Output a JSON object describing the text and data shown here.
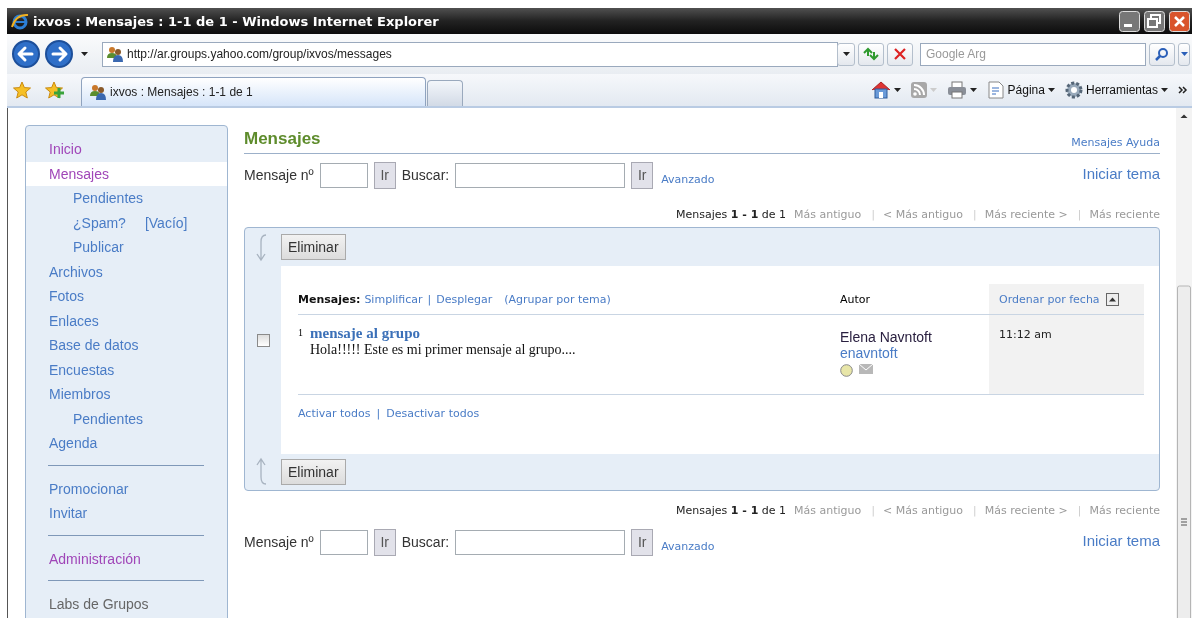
{
  "window": {
    "title": "ixvos : Mensajes : 1-1 de 1 - Windows Internet Explorer"
  },
  "address_bar": {
    "url": "http://ar.groups.yahoo.com/group/ixvos/messages"
  },
  "search_box": {
    "placeholder": "Google Arg"
  },
  "tabs": [
    {
      "label": "ixvos : Mensajes : 1-1 de 1",
      "selected": true
    }
  ],
  "command_bar": [
    {
      "label": "Página",
      "kind": "page"
    },
    {
      "label": "Herramientas",
      "kind": "tools"
    }
  ],
  "sidebar": {
    "groups": [
      {
        "items": [
          {
            "label": "Inicio",
            "kind": "visited",
            "selected": false
          },
          {
            "label": "Mensajes",
            "kind": "visited",
            "selected": true,
            "children": [
              {
                "label": "Pendientes",
                "kind": "link",
                "selected": false
              },
              {
                "label": "¿Spam?",
                "extra": "[Vacío]",
                "kind": "link",
                "selected": false
              },
              {
                "label": "Publicar",
                "kind": "link",
                "selected": false
              }
            ]
          },
          {
            "label": "Archivos",
            "kind": "link",
            "selected": false
          },
          {
            "label": "Fotos",
            "kind": "link",
            "selected": false
          },
          {
            "label": "Enlaces",
            "kind": "link",
            "selected": false
          },
          {
            "label": "Base de datos",
            "kind": "link",
            "selected": false
          },
          {
            "label": "Encuestas",
            "kind": "link",
            "selected": false
          },
          {
            "label": "Miembros",
            "kind": "link",
            "selected": false,
            "children": [
              {
                "label": "Pendientes",
                "kind": "link",
                "selected": false
              }
            ]
          },
          {
            "label": "Agenda",
            "kind": "link",
            "selected": false
          }
        ]
      },
      {
        "items": [
          {
            "label": "Promocionar",
            "kind": "link",
            "selected": false
          },
          {
            "label": "Invitar",
            "kind": "link",
            "selected": false
          }
        ]
      },
      {
        "items": [
          {
            "label": "Administración",
            "kind": "visited",
            "selected": false
          }
        ]
      },
      {
        "items": [
          {
            "label": "Labs de Grupos",
            "kind": "text",
            "selected": false
          }
        ]
      }
    ]
  },
  "page": {
    "title": "Mensajes",
    "help_link": "Mensajes Ayuda",
    "controls": [
      {
        "number_label": "Mensaje nº",
        "go_button": "Ir",
        "search_label": "Buscar:",
        "search_button": "Ir",
        "advanced_link": "Avanzado",
        "new_topic_link": "Iniciar tema"
      },
      {
        "number_label": "Mensaje nº",
        "go_button": "Ir",
        "search_label": "Buscar:",
        "search_button": "Ir",
        "advanced_link": "Avanzado",
        "new_topic_link": "Iniciar tema"
      }
    ],
    "pagers": [
      {
        "summary": "Mensajes **1 - 1** de 1",
        "links": [
          {
            "label": "Más antiguo",
            "kind": "disabled"
          },
          {
            "label": "|",
            "kind": "separator"
          },
          {
            "label": "< Más antiguo",
            "kind": "disabled"
          },
          {
            "label": "|",
            "kind": "separator"
          },
          {
            "label": "Más reciente >",
            "kind": "disabled"
          },
          {
            "label": "|",
            "kind": "separator"
          },
          {
            "label": "Más reciente",
            "kind": "disabled"
          }
        ]
      },
      {
        "summary": "Mensajes **1 - 1** de 1",
        "links": [
          {
            "label": "Más antiguo",
            "kind": "disabled"
          },
          {
            "label": "|",
            "kind": "separator"
          },
          {
            "label": "< Más antiguo",
            "kind": "disabled"
          },
          {
            "label": "|",
            "kind": "separator"
          },
          {
            "label": "Más reciente >",
            "kind": "disabled"
          },
          {
            "label": "|",
            "kind": "separator"
          },
          {
            "label": "Más reciente",
            "kind": "disabled"
          }
        ]
      }
    ],
    "list": {
      "delete_buttons": [
        "Eliminar",
        "Eliminar"
      ],
      "view": [
        {
          "label": "Mensajes:",
          "kind": "label"
        },
        {
          "label": "Simplificar",
          "kind": "link"
        },
        {
          "label": "|",
          "kind": "separator"
        },
        {
          "label": "Desplegar",
          "kind": "link"
        },
        {
          "label": "(Agrupar por tema)",
          "kind": "link"
        }
      ],
      "author_header": "Autor",
      "sort_header": "Ordenar por fecha",
      "rows": [
        {
          "checked": false,
          "number": "1",
          "subject": "mensaje al grupo",
          "preview": "Hola!!!!! Este es mi primer mensaje al grupo....",
          "author_name": "Elena Navntoft",
          "author_id": "enavntoft",
          "time": "11:12 am"
        }
      ],
      "select_links": [
        {
          "label": "Activar todos",
          "kind": "link"
        },
        {
          "label": "|",
          "kind": "separator"
        },
        {
          "label": "Desactivar todos",
          "kind": "link"
        }
      ]
    }
  }
}
